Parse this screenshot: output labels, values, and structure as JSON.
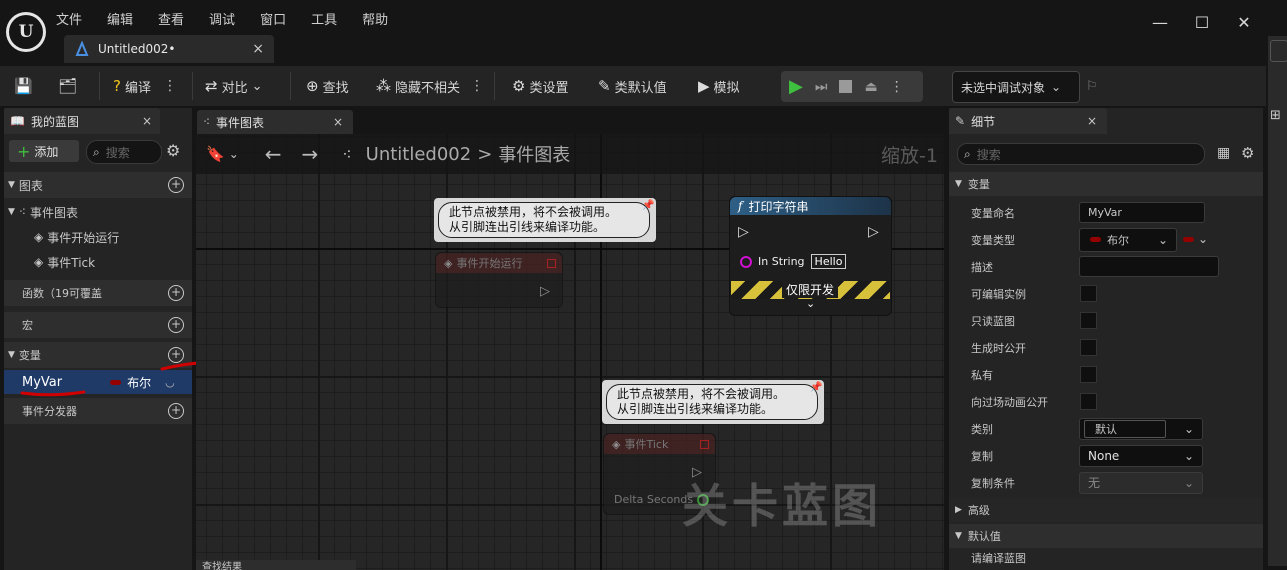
{
  "menu": [
    "文件",
    "编辑",
    "查看",
    "调试",
    "窗口",
    "工具",
    "帮助"
  ],
  "doc_tab": {
    "title": "Untitled002•",
    "close": "×"
  },
  "window": {
    "minimize": "—",
    "maximize": "☐",
    "close": "✕"
  },
  "toolbar": {
    "compile": "编译",
    "diff": "对比",
    "find": "查找",
    "hide_unrelated": "隐藏不相关",
    "class_settings": "类设置",
    "class_defaults": "类默认值",
    "simulate": "模拟",
    "debug_target": "未选中调试对象"
  },
  "my_blueprint": {
    "tab": "我的蓝图",
    "add": "添加",
    "search_placeholder": "搜索",
    "sections": {
      "graphs": "图表",
      "functions": "函数（19可覆盖",
      "macros": "宏",
      "variables": "变量",
      "dispatchers": "事件分发器"
    },
    "event_graph": "事件图表",
    "events": [
      "事件开始运行",
      "事件Tick"
    ],
    "variable": {
      "name": "MyVar",
      "type": "布尔"
    }
  },
  "graph": {
    "tab": "事件图表",
    "breadcrumb_root": "Untitled002",
    "breadcrumb_sep": ">",
    "breadcrumb_current": "事件图表",
    "zoom": "缩放-1",
    "disabled_comment": "此节点被禁用，将不会被调用。\n从引脚连出引线来编译功能。",
    "node_begin": "事件开始运行",
    "node_tick": "事件Tick",
    "delta_seconds": "Delta Seconds",
    "print_node": "打印字符串",
    "in_string": "In String",
    "in_string_value": "Hello",
    "dev_only": "仅限开发",
    "watermark": "关卡蓝图",
    "find_results": "查找结果"
  },
  "details": {
    "tab": "细节",
    "search_placeholder": "搜索",
    "variable_section": "变量",
    "fields": {
      "name_label": "变量命名",
      "name_value": "MyVar",
      "type_label": "变量类型",
      "type_value": "布尔",
      "desc_label": "描述",
      "editable_label": "可编辑实例",
      "readonly_label": "只读蓝图",
      "expose_spawn_label": "生成时公开",
      "private_label": "私有",
      "expose_cine_label": "向过场动画公开",
      "category_label": "类别",
      "category_value": "默认",
      "replication_label": "复制",
      "replication_value": "None",
      "rep_condition_label": "复制条件",
      "rep_condition_value": "无"
    },
    "advanced": "高级",
    "default_value": "默认值",
    "compile_hint": "请编译蓝图"
  },
  "colors": {
    "accent_play": "#3fbf3f",
    "bool_pin": "#950000",
    "annotation": "#d10000"
  }
}
